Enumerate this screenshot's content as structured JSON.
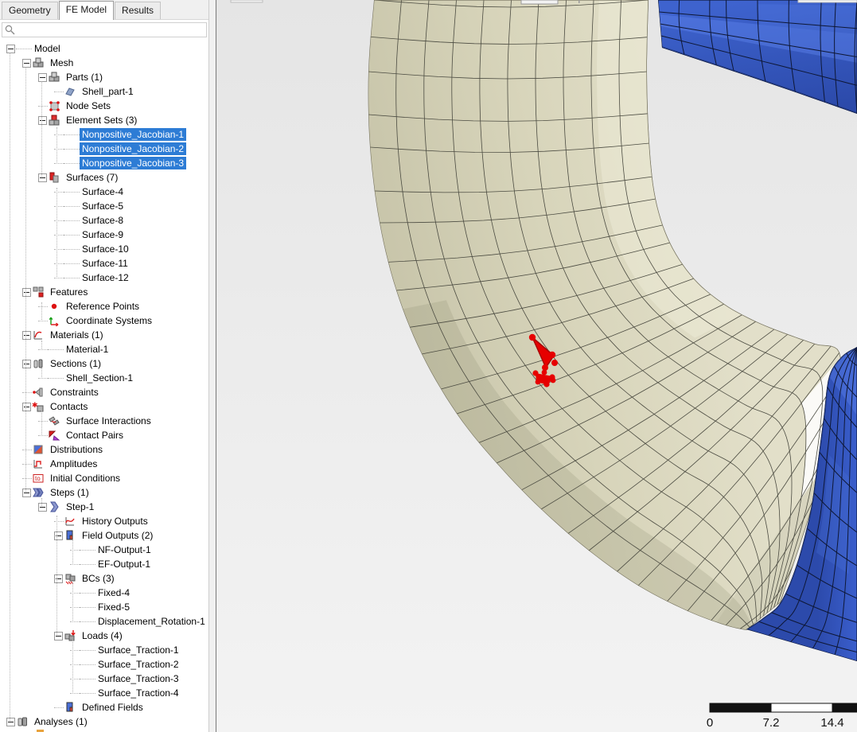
{
  "tabs": [
    {
      "label": "Geometry",
      "active": false
    },
    {
      "label": "FE Model",
      "active": true
    },
    {
      "label": "Results",
      "active": false
    }
  ],
  "search": {
    "value": "",
    "placeholder": ""
  },
  "colors": {
    "selection_bg": "#2d7cd5",
    "part_mesh": "#d8d5bb",
    "secondary_part": "#3356c0",
    "error_elements": "#e60000"
  },
  "tree": {
    "items": [
      {
        "label": "Model",
        "level": 0,
        "icon": null,
        "expand": true,
        "selected": false
      },
      {
        "label": "Mesh",
        "level": 1,
        "icon": "mesh",
        "expand": true,
        "selected": false
      },
      {
        "label": "Parts (1)",
        "level": 2,
        "icon": "parts",
        "expand": true,
        "selected": false
      },
      {
        "label": "Shell_part-1",
        "level": 3,
        "icon": "shell-part",
        "expand": false,
        "selected": false
      },
      {
        "label": "Node Sets",
        "level": 2,
        "icon": "node-sets",
        "expand": false,
        "selected": false
      },
      {
        "label": "Element Sets (3)",
        "level": 2,
        "icon": "element-sets",
        "expand": true,
        "selected": false
      },
      {
        "label": "Nonpositive_Jacobian-1",
        "level": 3,
        "icon": null,
        "expand": false,
        "selected": true
      },
      {
        "label": "Nonpositive_Jacobian-2",
        "level": 3,
        "icon": null,
        "expand": false,
        "selected": true
      },
      {
        "label": "Nonpositive_Jacobian-3",
        "level": 3,
        "icon": null,
        "expand": false,
        "selected": true
      },
      {
        "label": "Surfaces (7)",
        "level": 2,
        "icon": "surfaces",
        "expand": true,
        "selected": false
      },
      {
        "label": "Surface-4",
        "level": 3,
        "icon": null,
        "expand": false,
        "selected": false
      },
      {
        "label": "Surface-5",
        "level": 3,
        "icon": null,
        "expand": false,
        "selected": false
      },
      {
        "label": "Surface-8",
        "level": 3,
        "icon": null,
        "expand": false,
        "selected": false
      },
      {
        "label": "Surface-9",
        "level": 3,
        "icon": null,
        "expand": false,
        "selected": false
      },
      {
        "label": "Surface-10",
        "level": 3,
        "icon": null,
        "expand": false,
        "selected": false
      },
      {
        "label": "Surface-11",
        "level": 3,
        "icon": null,
        "expand": false,
        "selected": false
      },
      {
        "label": "Surface-12",
        "level": 3,
        "icon": null,
        "expand": false,
        "selected": false
      },
      {
        "label": "Features",
        "level": 1,
        "icon": "features",
        "expand": true,
        "selected": false
      },
      {
        "label": "Reference Points",
        "level": 2,
        "icon": "reference-points",
        "expand": false,
        "selected": false
      },
      {
        "label": "Coordinate Systems",
        "level": 2,
        "icon": "coordinate-systems",
        "expand": false,
        "selected": false
      },
      {
        "label": "Materials (1)",
        "level": 1,
        "icon": "materials",
        "expand": true,
        "selected": false
      },
      {
        "label": "Material-1",
        "level": 2,
        "icon": null,
        "expand": false,
        "selected": false
      },
      {
        "label": "Sections (1)",
        "level": 1,
        "icon": "sections",
        "expand": true,
        "selected": false
      },
      {
        "label": "Shell_Section-1",
        "level": 2,
        "icon": null,
        "expand": false,
        "selected": false
      },
      {
        "label": "Constraints",
        "level": 1,
        "icon": "constraints",
        "expand": false,
        "selected": false
      },
      {
        "label": "Contacts",
        "level": 1,
        "icon": "contacts",
        "expand": true,
        "selected": false
      },
      {
        "label": "Surface Interactions",
        "level": 2,
        "icon": "surface-interactions",
        "expand": false,
        "selected": false
      },
      {
        "label": "Contact Pairs",
        "level": 2,
        "icon": "contact-pairs",
        "expand": false,
        "selected": false
      },
      {
        "label": "Distributions",
        "level": 1,
        "icon": "distributions",
        "expand": false,
        "selected": false
      },
      {
        "label": "Amplitudes",
        "level": 1,
        "icon": "amplitudes",
        "expand": false,
        "selected": false
      },
      {
        "label": "Initial Conditions",
        "level": 1,
        "icon": "initial-conditions",
        "expand": false,
        "selected": false
      },
      {
        "label": "Steps (1)",
        "level": 1,
        "icon": "steps",
        "expand": true,
        "selected": false
      },
      {
        "label": "Step-1",
        "level": 2,
        "icon": "step",
        "expand": true,
        "selected": false
      },
      {
        "label": "History Outputs",
        "level": 3,
        "icon": "history-outputs",
        "expand": false,
        "selected": false
      },
      {
        "label": "Field Outputs (2)",
        "level": 3,
        "icon": "field-outputs",
        "expand": true,
        "selected": false
      },
      {
        "label": "NF-Output-1",
        "level": 4,
        "icon": null,
        "expand": false,
        "selected": false
      },
      {
        "label": "EF-Output-1",
        "level": 4,
        "icon": null,
        "expand": false,
        "selected": false
      },
      {
        "label": "BCs (3)",
        "level": 3,
        "icon": "bcs",
        "expand": true,
        "selected": false
      },
      {
        "label": "Fixed-4",
        "level": 4,
        "icon": null,
        "expand": false,
        "selected": false
      },
      {
        "label": "Fixed-5",
        "level": 4,
        "icon": null,
        "expand": false,
        "selected": false
      },
      {
        "label": "Displacement_Rotation-1",
        "level": 4,
        "icon": null,
        "expand": false,
        "selected": false
      },
      {
        "label": "Loads (4)",
        "level": 3,
        "icon": "loads",
        "expand": true,
        "selected": false
      },
      {
        "label": "Surface_Traction-1",
        "level": 4,
        "icon": null,
        "expand": false,
        "selected": false
      },
      {
        "label": "Surface_Traction-2",
        "level": 4,
        "icon": null,
        "expand": false,
        "selected": false
      },
      {
        "label": "Surface_Traction-3",
        "level": 4,
        "icon": null,
        "expand": false,
        "selected": false
      },
      {
        "label": "Surface_Traction-4",
        "level": 4,
        "icon": null,
        "expand": false,
        "selected": false
      },
      {
        "label": "Defined Fields",
        "level": 3,
        "icon": "defined-fields",
        "expand": false,
        "selected": false
      },
      {
        "label": "Analyses (1)",
        "level": 0,
        "icon": "analyses",
        "expand": true,
        "selected": false
      }
    ]
  },
  "viewport": {
    "scale_bar": {
      "tick_labels": [
        "0",
        "7.2",
        "14.4"
      ]
    }
  }
}
